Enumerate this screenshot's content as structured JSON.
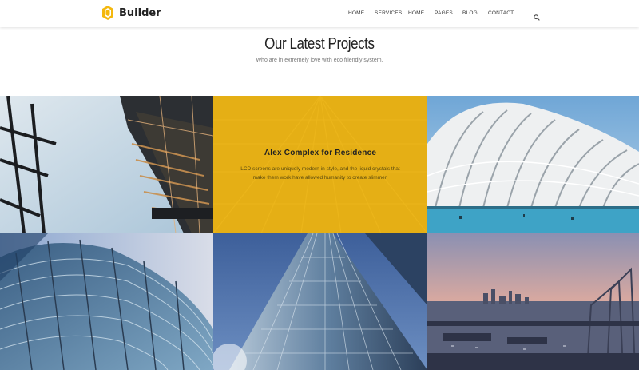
{
  "header": {
    "brand": "Builder",
    "nav": [
      {
        "label": "HOME",
        "name": "nav-home-1"
      },
      {
        "label": "SERVICES",
        "name": "nav-services"
      },
      {
        "label": "HOME",
        "name": "nav-home-2"
      },
      {
        "label": "PAGES",
        "name": "nav-pages"
      },
      {
        "label": "BLOG",
        "name": "nav-blog"
      },
      {
        "label": "CONTACT",
        "name": "nav-contact"
      }
    ],
    "search_icon": "search-icon",
    "accent_color": "#f4b80e"
  },
  "section": {
    "title": "Our Latest Projects",
    "subtitle": "Who are in extremely love with eco friendly system."
  },
  "projects": [
    {
      "name": "project-steel-tower"
    },
    {
      "name": "project-alex-complex",
      "title": "Alex Complex for Residence",
      "text": "LCD screens are uniquely modern in style, and the liquid crystals that make them work have allowed humanity to create slimmer."
    },
    {
      "name": "project-white-arches"
    },
    {
      "name": "project-curved-glass"
    },
    {
      "name": "project-glass-skyscraper"
    },
    {
      "name": "project-harbor-city"
    }
  ]
}
